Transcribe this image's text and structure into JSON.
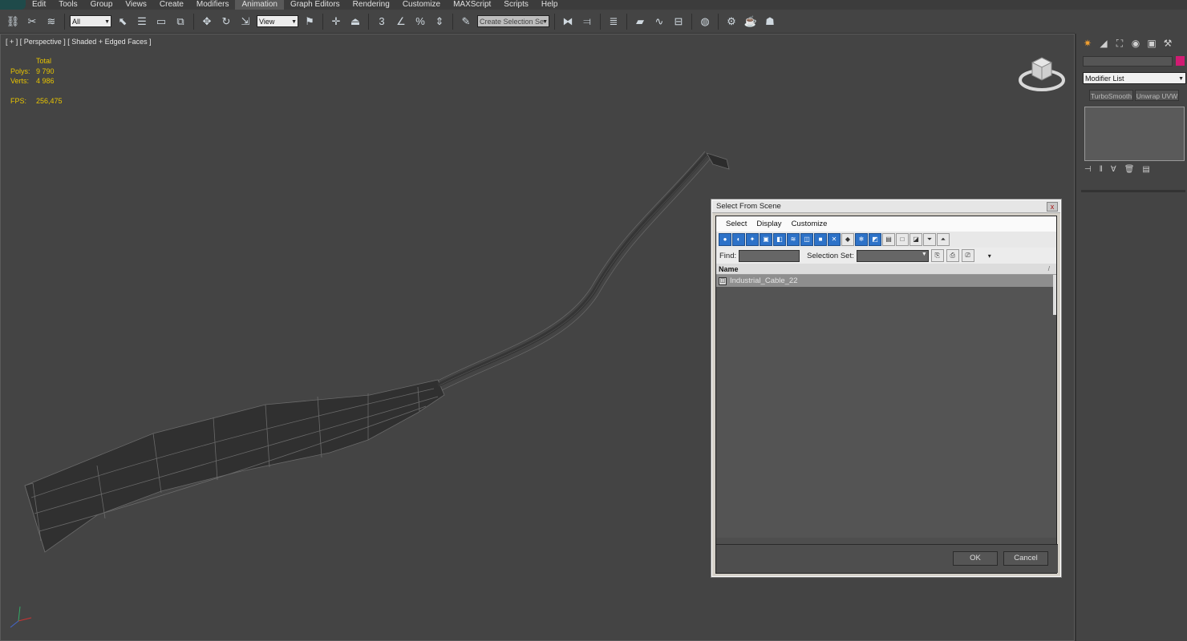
{
  "menu": {
    "items": [
      "Edit",
      "Tools",
      "Group",
      "Views",
      "Create",
      "Modifiers",
      "Animation",
      "Graph Editors",
      "Rendering",
      "Customize",
      "MAXScript",
      "Scripts",
      "Help"
    ],
    "active": "Animation"
  },
  "toolbar": {
    "selection_filter": "All",
    "reference_coord": "View",
    "selection_set_placeholder": "Create Selection Se",
    "snap_label": "3",
    "angle_snap_label": "%"
  },
  "viewport": {
    "label": "[ + ] [ Perspective ] [ Shaded + Edged Faces ]",
    "stats": {
      "header": "Total",
      "polys_label": "Polys:",
      "polys_value": "9 790",
      "verts_label": "Verts:",
      "verts_value": "4 986",
      "fps_label": "FPS:",
      "fps_value": "256,475"
    }
  },
  "command_panel": {
    "modifier_list": "Modifier List",
    "modifier_buttons": [
      "TurboSmooth",
      "Unwrap UVW"
    ],
    "object_color": "#d11b72"
  },
  "dialog": {
    "title": "Select From Scene",
    "close_label": "x",
    "menus": [
      "Select",
      "Display",
      "Customize"
    ],
    "find_label": "Find:",
    "selection_set_label": "Selection Set:",
    "column_header": "Name",
    "rows": [
      "Industrial_Cable_22"
    ],
    "ok_label": "OK",
    "cancel_label": "Cancel"
  },
  "colors": {
    "viewport_bg": "#444444",
    "stats_text": "#e8c400",
    "highlight_blue": "#2d72c8"
  }
}
